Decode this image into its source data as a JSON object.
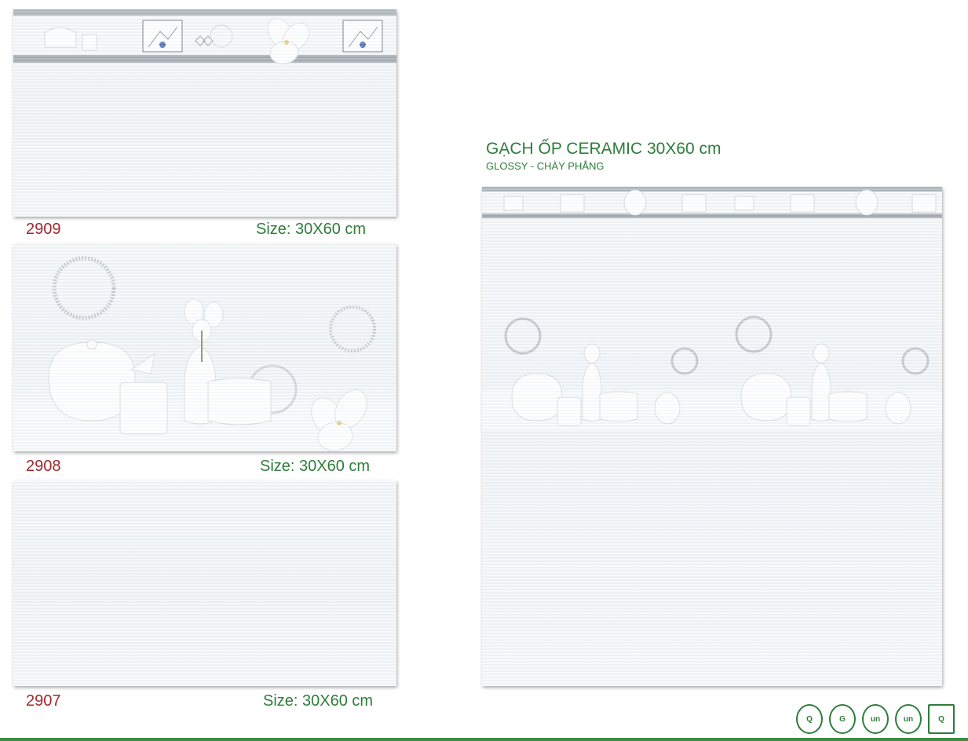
{
  "heading": {
    "title": "GẠCH ỐP CERAMIC 30X60 cm",
    "subtitle": "GLOSSY - CHÀY PHẲNG"
  },
  "tiles": [
    {
      "code": "2909",
      "size": "Size: 30X60 cm"
    },
    {
      "code": "2908",
      "size": "Size: 30X60 cm"
    },
    {
      "code": "2907",
      "size": "Size: 30X60 cm"
    }
  ],
  "colors": {
    "code": "#a0282d",
    "green": "#2e7d3a"
  },
  "icons": [
    "quacert-logo-icon",
    "jas-anz-cert-icon",
    "un-quacert-icon",
    "un-quacert-icon-2",
    "q-cert-icon"
  ]
}
